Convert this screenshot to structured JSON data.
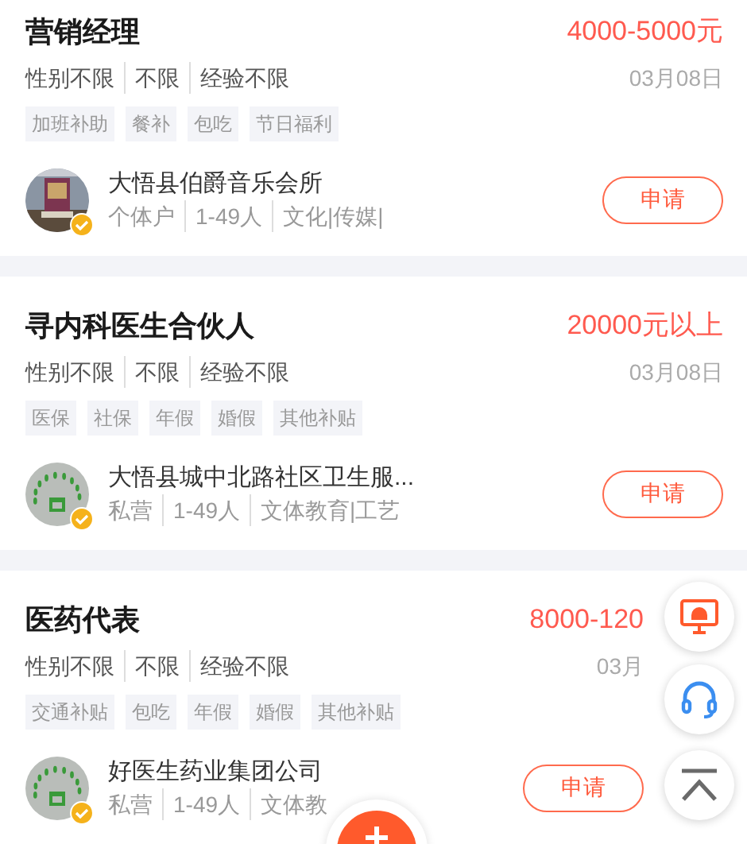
{
  "jobs": [
    {
      "title": "营销经理",
      "salary": "4000-5000元",
      "requirements": [
        "性别不限",
        "不限",
        "经验不限"
      ],
      "date": "03月08日",
      "benefits": [
        "加班补助",
        "餐补",
        "包吃",
        "节日福利"
      ],
      "company": {
        "name": "大悟县伯爵音乐会所",
        "meta": [
          "个体户",
          "1-49人",
          "文化|传媒|"
        ],
        "logo": {
          "kind": "picture"
        },
        "verified": true
      },
      "apply": "申请"
    },
    {
      "title": "寻内科医生合伙人",
      "salary": "20000元以上",
      "requirements": [
        "性别不限",
        "不限",
        "经验不限"
      ],
      "date": "03月08日",
      "benefits": [
        "医保",
        "社保",
        "年假",
        "婚假",
        "其他补贴"
      ],
      "company": {
        "name": "大悟县城中北路社区卫生服...",
        "meta": [
          "私营",
          "1-49人",
          "文体教育|工艺"
        ],
        "logo": {
          "kind": "emblem"
        },
        "verified": true
      },
      "apply": "申请"
    },
    {
      "title": "医药代表",
      "salary": "8000-120",
      "requirements": [
        "性别不限",
        "不限",
        "经验不限"
      ],
      "date": "03月",
      "benefits": [
        "交通补贴",
        "包吃",
        "年假",
        "婚假",
        "其他补贴"
      ],
      "company": {
        "name": "好医生药业集团公司",
        "meta": [
          "私营",
          "1-49人",
          "文体教"
        ],
        "logo": {
          "kind": "emblem"
        },
        "verified": true
      },
      "apply": "申请"
    }
  ],
  "floating_actions": [
    {
      "kind": "screen"
    },
    {
      "kind": "headset"
    },
    {
      "kind": "top"
    }
  ],
  "add_button": {
    "kind": "add"
  }
}
